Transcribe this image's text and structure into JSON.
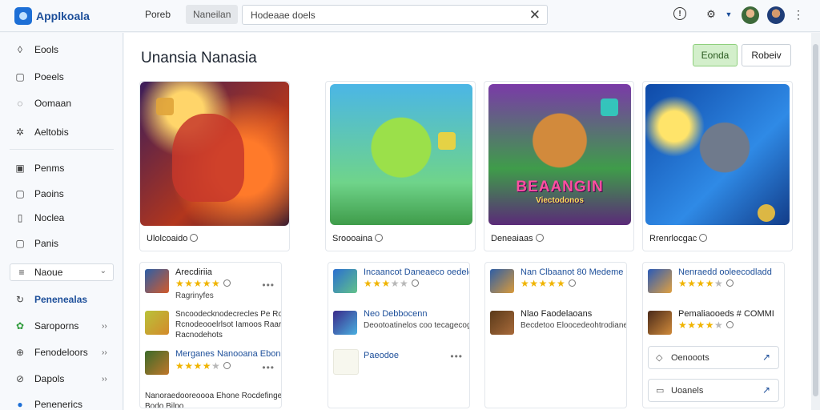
{
  "app": {
    "title": "Applkoala"
  },
  "header": {
    "tabs": [
      {
        "label": "Poreb"
      },
      {
        "label": "Naneilan"
      }
    ],
    "search": {
      "value": "Hodeaae doels",
      "placeholder": ""
    },
    "icons": {
      "info": "info-icon",
      "gear": "gear-icon",
      "caret": "caret-down-icon",
      "more": "kebab-icon",
      "close": "close-icon"
    }
  },
  "sidebar": {
    "items": [
      {
        "label": "Eools",
        "icon": "leaf-icon",
        "glyph": "◊"
      },
      {
        "label": "Poeels",
        "icon": "square-icon",
        "glyph": "▢"
      },
      {
        "label": "Oomaan",
        "icon": "chat-icon",
        "glyph": "◌"
      },
      {
        "label": "Aeltobis",
        "icon": "gear-icon",
        "glyph": "✲"
      },
      {
        "label": "Penms",
        "icon": "document-icon",
        "glyph": "▣"
      },
      {
        "label": "Paoins",
        "icon": "box-icon",
        "glyph": "▢"
      },
      {
        "label": "Noclea",
        "icon": "file-icon",
        "glyph": "▯"
      },
      {
        "label": "Panis",
        "icon": "clipboard-icon",
        "glyph": "▢"
      }
    ],
    "select": {
      "label": "Naoue",
      "icon": "menu-icon",
      "glyph": "≡",
      "chevron": "⌄"
    },
    "nav": [
      {
        "label": "Penenealas",
        "icon": "refresh-icon",
        "glyph": "↻",
        "arrow": ""
      },
      {
        "label": "Saroporns",
        "icon": "puzzle-icon",
        "glyph": "✿",
        "arrow": "››"
      },
      {
        "label": "Fenodeloors",
        "icon": "globe-icon",
        "glyph": "⊕",
        "arrow": "››"
      },
      {
        "label": "Dapols",
        "icon": "pin-icon",
        "glyph": "⊘",
        "arrow": "››"
      },
      {
        "label": "Penenerics",
        "icon": "circle-icon",
        "glyph": "●",
        "arrow": ""
      }
    ]
  },
  "main": {
    "title": "Unansia Nanasia",
    "buttons": {
      "primary": "Eonda",
      "secondary": "Robeiv"
    },
    "featured": [
      {
        "caption": "Ulolcoaido"
      },
      {
        "caption": "Sroooaina"
      },
      {
        "caption": "Deneaiaas",
        "banner_title": "BEAANGIN",
        "banner_sub": "Viectodonos"
      },
      {
        "caption": "Rrenrlocgac"
      }
    ],
    "lists": [
      {
        "rows": [
          {
            "title": "Arecdiriia",
            "stars_filled": "★★★★★",
            "stars_empty": "",
            "sub": "Ragrinyfes"
          },
          {
            "desc1": "Sncoodecknodecrecles Pe Ro",
            "desc2": "Rcnodeooelrlsot Iamoos Raary / Ao",
            "desc3": "Racnodehots"
          },
          {
            "title": "Merganes Nanooana Ebond",
            "stars_filled": "★★★★",
            "stars_empty": "★"
          },
          {
            "desc1": "Nanoraedooreoooa Ehone Rocdefingecoo",
            "desc2": "Bodo Bilpo"
          }
        ]
      },
      {
        "rows": [
          {
            "title": "Incaancot Daneaeco oedeld",
            "stars_filled": "★★★",
            "stars_empty": "★★"
          },
          {
            "title": "Neo Debbocenn",
            "sub": "Deootoatinelos coo tecagecogoou"
          },
          {
            "title": "Paeodoe"
          }
        ]
      },
      {
        "rows": [
          {
            "title": "Nan Clbaanot 80 Medeme",
            "stars_filled": "★★★★★",
            "stars_empty": ""
          },
          {
            "title": "Nlao Faodelaoans",
            "sub": "Becdetoo Eloocedeohtrodiane",
            "dark": true
          }
        ]
      },
      {
        "rows": [
          {
            "title": "Nenraedd ooleecodladd",
            "stars_filled": "★★★★",
            "stars_empty": "★"
          },
          {
            "title": "Pemaliaooeds # COMMI",
            "stars_filled": "★★★★",
            "stars_empty": "★",
            "dark": true
          }
        ],
        "links": [
          {
            "label": "Oenooots",
            "icon": "chat-icon",
            "glyph": "◇",
            "arrow": "↗"
          },
          {
            "label": "Uoanels",
            "icon": "archive-icon",
            "glyph": "▭",
            "arrow": "↗"
          }
        ]
      }
    ]
  },
  "colors": {
    "accent": "#1d4f9a",
    "brand": "#1d6fd6",
    "star": "#f0b400",
    "primary_button": "#d3efcb"
  }
}
